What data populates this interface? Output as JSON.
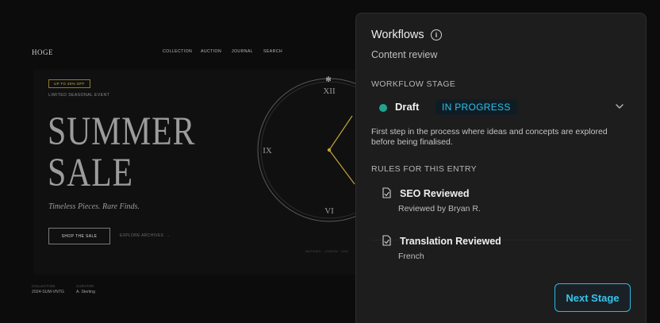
{
  "site": {
    "logo": "HOGE",
    "nav": [
      "COLLECTION",
      "AUCTION",
      "JOURNAL",
      "SEARCH"
    ],
    "promo_badge": "UP TO 40% OFF",
    "event_label": "LIMITED SEASONAL EVENT",
    "hero_line1": "SUMMER",
    "hero_line2": "SALE",
    "tagline": "Timeless Pieces. Rare Finds.",
    "shop_button": "SHOP THE SALE",
    "explore_link": "EXPLORE ARCHIVES",
    "collection_key": "COLLECTION",
    "collection_value": "2024-SUM-VNTG",
    "curator_key": "CURATOR",
    "curator_value": "A. Sterling",
    "credit": "WATCHES · LONDON · 1942",
    "clock_numerals": {
      "top": "XII",
      "left": "IX",
      "bottom": "VI"
    }
  },
  "panel": {
    "title": "Workflows",
    "info_icon": "info-icon",
    "subtitle": "Content review",
    "stage_heading": "WORKFLOW STAGE",
    "stage_name": "Draft",
    "stage_status": "IN PROGRESS",
    "stage_description": "First step in the process where ideas and concepts are explored before being finalised.",
    "rules_heading": "RULES FOR THIS ENTRY",
    "rules": [
      {
        "icon": "document-check-icon",
        "title": "SEO Reviewed",
        "detail": "Reviewed by Bryan R."
      },
      {
        "icon": "document-check-icon",
        "title": "Translation Reviewed",
        "detail": "French"
      }
    ],
    "next_button": "Next Stage",
    "colors": {
      "stage_dot": "#1fa38e",
      "accent": "#2ec0e8",
      "promo": "#c9b24a"
    }
  }
}
